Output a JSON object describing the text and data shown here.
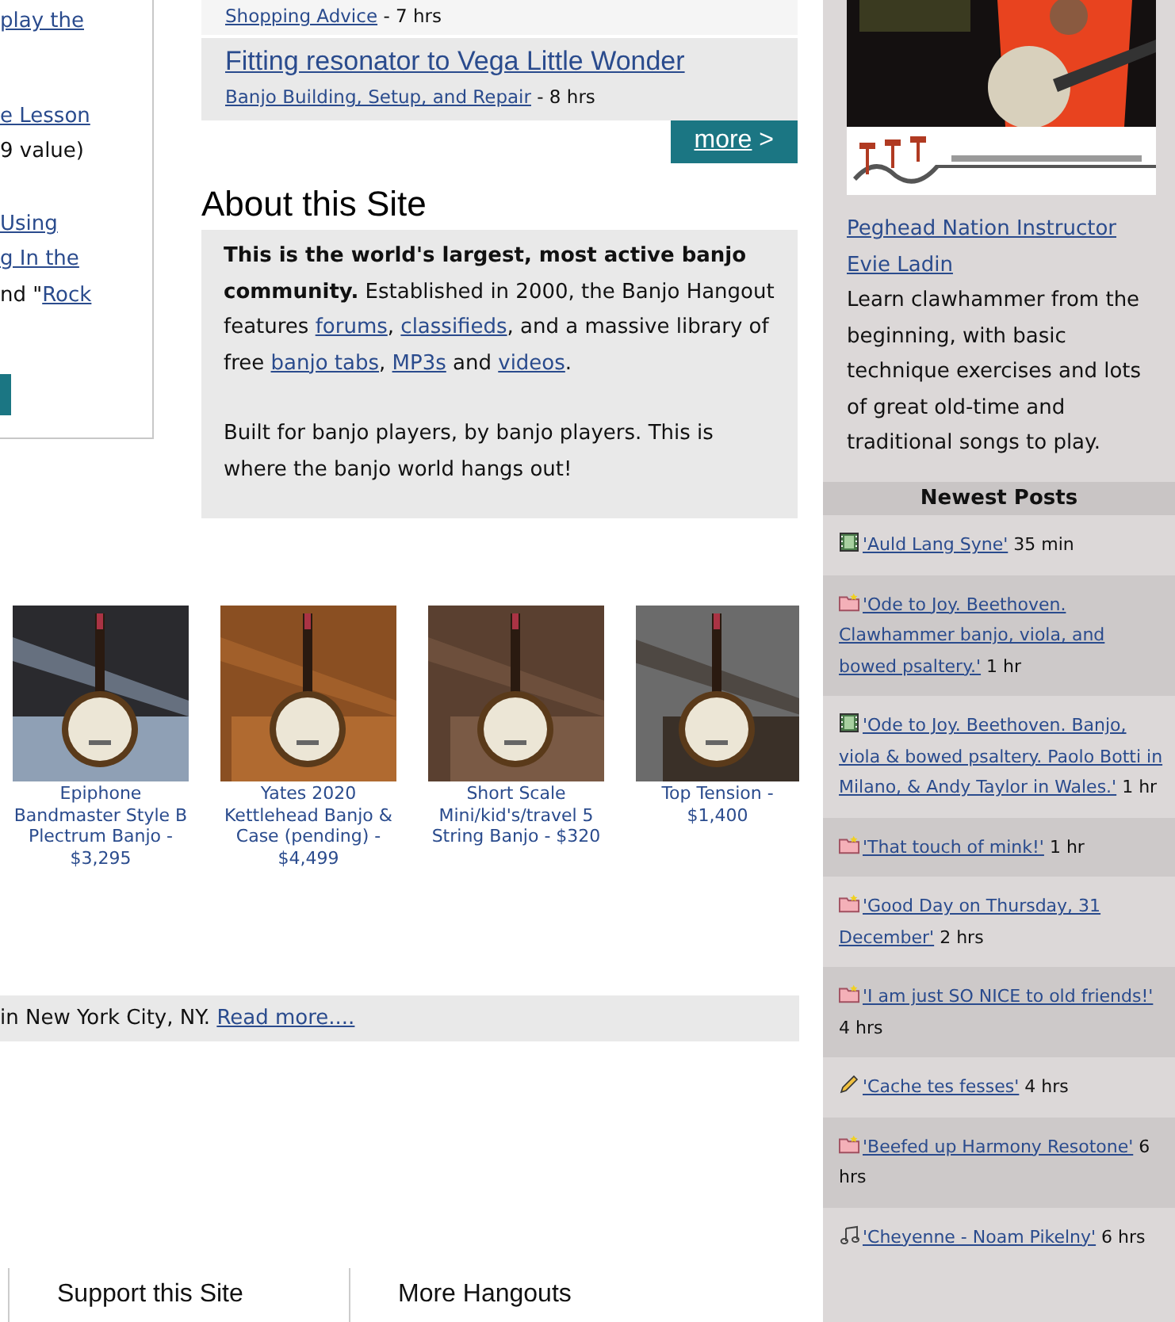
{
  "left_panel": {
    "paragraphs": [
      {
        "lines": [
          [
            {
              "kind": "link",
              "text": "play the"
            }
          ]
        ]
      },
      {
        "lines": [
          [
            {
              "kind": "link",
              "text": "e Lesson"
            }
          ],
          [
            {
              "kind": "plain",
              "text": "9 value)"
            }
          ]
        ]
      },
      {
        "lines": [
          [
            {
              "kind": "link",
              "text": "Using"
            }
          ],
          [
            {
              "kind": "link",
              "text": "g In the"
            }
          ],
          [
            {
              "kind": "plain",
              "text": "nd \""
            },
            {
              "kind": "link",
              "text": "Rock"
            }
          ]
        ]
      }
    ],
    "button": {
      "kind": "button"
    }
  },
  "forum_posts": [
    {
      "forum": "Shopping Advice",
      "time": "- 7 hrs"
    },
    {
      "title": "Fitting resonator to Vega Little Wonder",
      "forum": "Banjo Building, Setup, and Repair",
      "time": "- 8 hrs"
    }
  ],
  "more_button": {
    "label": "more",
    "arrow": ">"
  },
  "about": {
    "heading": "About this Site",
    "paragraphs": [
      [
        {
          "kind": "bold",
          "text": "This is the world's largest, most active banjo community."
        },
        {
          "kind": "plain",
          "text": " Established in 2000, the Banjo Hangout features "
        },
        {
          "kind": "link",
          "text": "forums"
        },
        {
          "kind": "plain",
          "text": ", "
        },
        {
          "kind": "link",
          "text": "classifieds"
        },
        {
          "kind": "plain",
          "text": ", and a massive library of free "
        },
        {
          "kind": "link",
          "text": "banjo tabs"
        },
        {
          "kind": "plain",
          "text": ", "
        },
        {
          "kind": "link",
          "text": "MP3s"
        },
        {
          "kind": "plain",
          "text": " and "
        },
        {
          "kind": "link",
          "text": "videos"
        },
        {
          "kind": "plain",
          "text": "."
        }
      ],
      [
        {
          "kind": "plain",
          "text": "Built for banjo players, by banjo players. This is where the banjo world hangs out!"
        }
      ]
    ]
  },
  "classifieds": [
    {
      "kind": "picture",
      "caption": "Epiphone Bandmaster Style B Plectrum Banjo - $3,295"
    },
    {
      "kind": "picture",
      "caption": "Yates 2020 Kettlehead Banjo & Case (pending) - $4,499"
    },
    {
      "kind": "picture",
      "caption": "Short Scale Mini/kid's/travel 5 String Banjo - $320"
    },
    {
      "kind": "picture",
      "caption": "Top Tension - $1,400"
    }
  ],
  "news_bar": {
    "text": "in New York City, NY. ",
    "link": "Read more...."
  },
  "footer": {
    "columns": [
      "Support this Site",
      "More Hangouts"
    ]
  },
  "sidebar": {
    "ad": {
      "kind": "picture",
      "link": "Peghead Nation Instructor Evie Ladin",
      "text": "Learn clawhammer from the beginning, with basic technique exercises and lots of great old-time and traditional songs to play."
    },
    "newest_posts": {
      "heading": "Newest Posts",
      "items": [
        {
          "kind": "video",
          "title": "'Auld Lang Syne'",
          "time": "35 min"
        },
        {
          "kind": "thread",
          "title": "'Ode to Joy. Beethoven. Clawhammer banjo, viola, and bowed psaltery.'",
          "time": "1 hr"
        },
        {
          "kind": "video",
          "title": "'Ode to Joy. Beethoven. Banjo, viola & bowed psaltery. Paolo Botti in Milano, & Andy Taylor in Wales.'",
          "time": "1 hr"
        },
        {
          "kind": "thread",
          "title": "'That touch of mink!'",
          "time": "1 hr"
        },
        {
          "kind": "thread",
          "title": "'Good Day on Thursday, 31 December'",
          "time": "2 hrs"
        },
        {
          "kind": "thread",
          "title": "'I am just SO NICE to old friends!'",
          "time": "4 hrs"
        },
        {
          "kind": "blog",
          "title": "'Cache tes fesses'",
          "time": "4 hrs"
        },
        {
          "kind": "thread",
          "title": "'Beefed up Harmony Resotone'",
          "time": "6 hrs"
        },
        {
          "kind": "audio",
          "title": "'Cheyenne - Noam Pikelny'",
          "time": "6 hrs"
        }
      ]
    }
  }
}
